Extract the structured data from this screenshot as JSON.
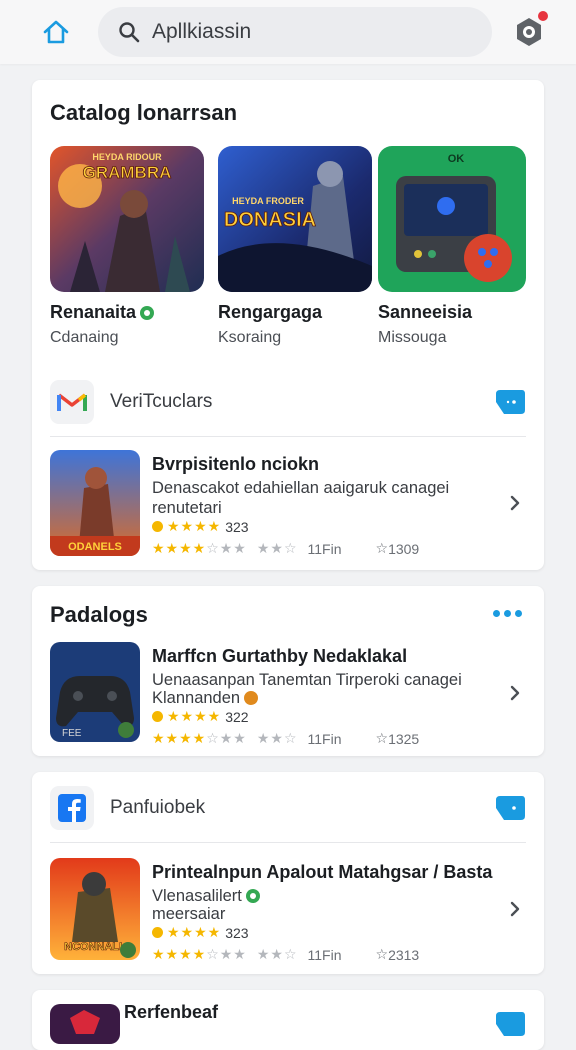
{
  "header": {
    "search_text": "Apllkiassin",
    "home_icon": "home-icon",
    "profile_icon": "profile-icon"
  },
  "section1": {
    "title": "Catalog lonarrsan",
    "featured": [
      {
        "name": "Renanaita",
        "sub": "Cdanaing",
        "art_text": "GRAMBRA",
        "art_top": "HEYDA RIDOUR"
      },
      {
        "name": "Rengargaga",
        "sub": "Ksoraing",
        "art_text": "DONASIA",
        "art_top": "HEYDA FRODER"
      },
      {
        "name": "Sanneeisia",
        "sub": "Missouga",
        "art_text": "OK"
      }
    ],
    "developer": {
      "label": "VeriTcuclars"
    },
    "app": {
      "title": "Bvrpisitenlo nciokn",
      "desc": "Denascakot edahiellan aaigaruk canagei renutetari",
      "rating": "323",
      "r2_mid": "11Fin",
      "r2_right": "1309",
      "icon_text": "ODANELS"
    }
  },
  "section2": {
    "title": "Padalogs",
    "app": {
      "title": "Marffcn Gurtathby Nedaklakal",
      "desc": "Uenaasanpan Tanemtan Tirperoki canagei",
      "desc2": "Klannanden",
      "rating": "322",
      "r2_mid": "11Fin",
      "r2_right": "1325",
      "icon_text": "FEE"
    }
  },
  "section3": {
    "developer": {
      "label": "Panfuiobek"
    },
    "app": {
      "title": "Printealnpun Apalout Matahgsar / Basta",
      "desc": "Vlenasalilert",
      "desc2": "meersaiar",
      "rating": "323",
      "r2_mid": "11Fin",
      "r2_right": "2313",
      "icon_text": "NCONNALL"
    }
  },
  "section4": {
    "title": "Rerfenbeaf"
  },
  "colors": {
    "accent": "#1a9be0",
    "star": "#f5b700",
    "green": "#34a853",
    "notify": "#e7343f"
  }
}
